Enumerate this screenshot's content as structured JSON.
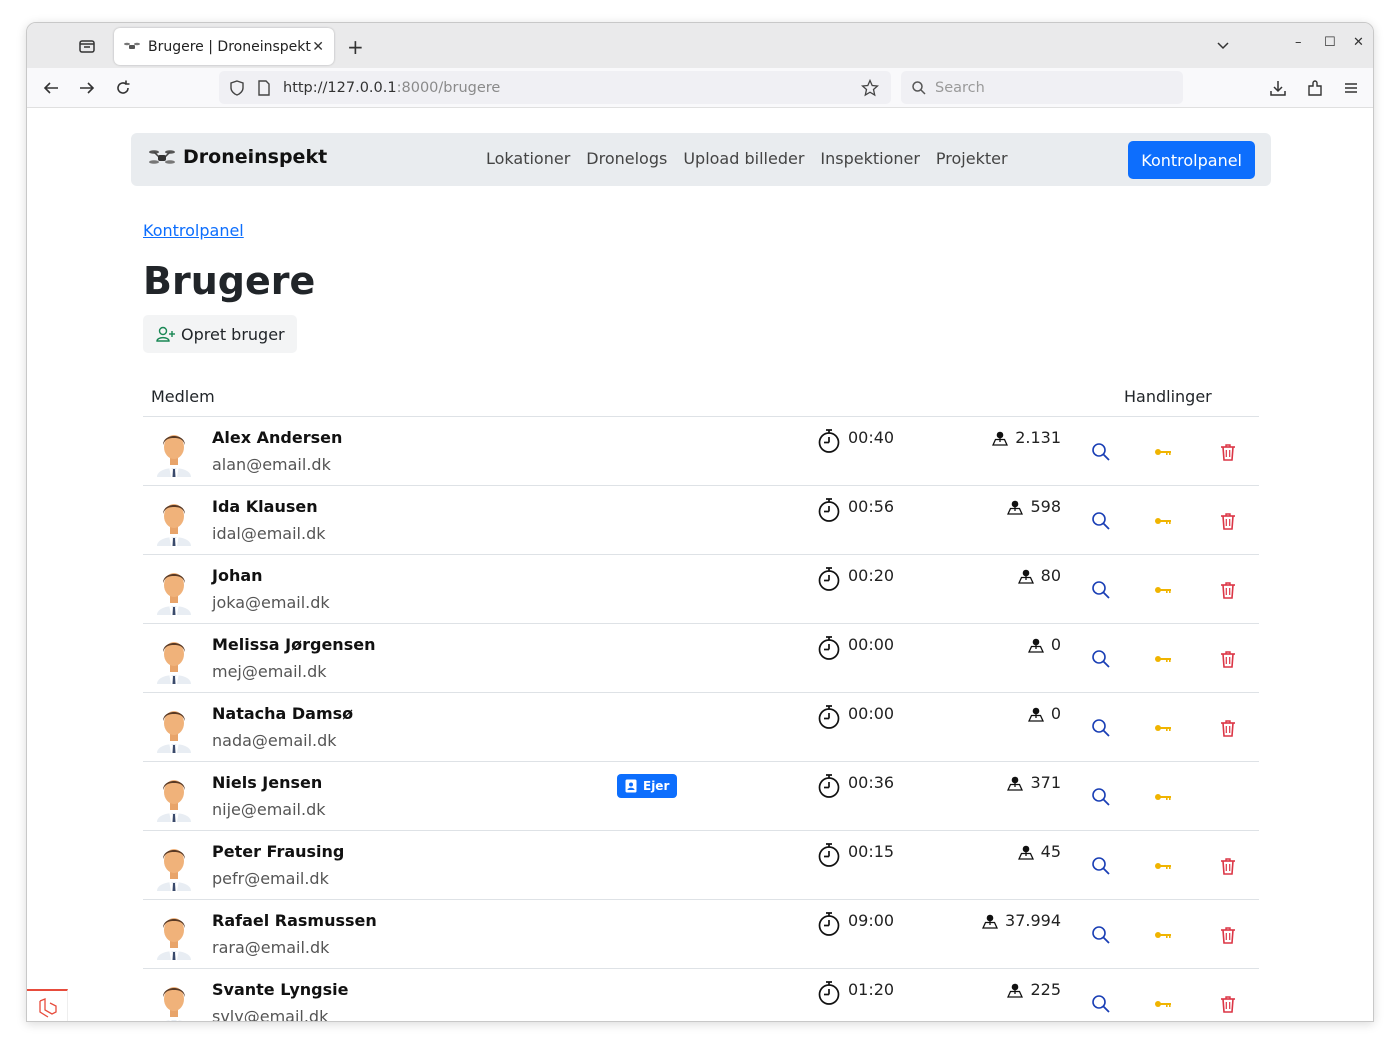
{
  "browser": {
    "tab_title": "Brugere | Droneinspekt",
    "tab_close": "✕",
    "new_tab": "+",
    "url_host": "http://127.0.0.1",
    "url_path": ":8000/brugere",
    "search_placeholder": "Search",
    "window_controls": {
      "minimize": "–",
      "maximize": "☐",
      "close": "✕"
    }
  },
  "site": {
    "brand": "Droneinspekt",
    "menu": [
      "Lokationer",
      "Dronelogs",
      "Upload billeder",
      "Inspektioner",
      "Projekter"
    ],
    "control_panel_button": "Kontrolpanel"
  },
  "page": {
    "breadcrumb": "Kontrolpanel",
    "title": "Brugere",
    "create_button": "Opret bruger",
    "table_headers": {
      "member": "Medlem",
      "actions": "Handlinger"
    }
  },
  "users": [
    {
      "name": "Alex Andersen",
      "email": "alan@email.dk",
      "time": "00:40",
      "count": "2.131",
      "badge": "",
      "deletable": true
    },
    {
      "name": "Ida Klausen",
      "email": "idal@email.dk",
      "time": "00:56",
      "count": "598",
      "badge": "",
      "deletable": true
    },
    {
      "name": "Johan",
      "email": "joka@email.dk",
      "time": "00:20",
      "count": "80",
      "badge": "",
      "deletable": true
    },
    {
      "name": "Melissa Jørgensen",
      "email": "mej@email.dk",
      "time": "00:00",
      "count": "0",
      "badge": "",
      "deletable": true
    },
    {
      "name": "Natacha Damsø",
      "email": "nada@email.dk",
      "time": "00:00",
      "count": "0",
      "badge": "",
      "deletable": true
    },
    {
      "name": "Niels Jensen",
      "email": "nije@email.dk",
      "time": "00:36",
      "count": "371",
      "badge": "Ejer",
      "deletable": false
    },
    {
      "name": "Peter Frausing",
      "email": "pefr@email.dk",
      "time": "00:15",
      "count": "45",
      "badge": "",
      "deletable": true
    },
    {
      "name": "Rafael Rasmussen",
      "email": "rara@email.dk",
      "time": "09:00",
      "count": "37.994",
      "badge": "",
      "deletable": true
    },
    {
      "name": "Svante Lyngsie",
      "email": "svly@email.dk",
      "time": "01:20",
      "count": "225",
      "badge": "",
      "deletable": true
    }
  ],
  "colors": {
    "primary": "#0d6efd",
    "view_icon": "#1a3fb5",
    "key_icon": "#f0b400",
    "delete_icon": "#dc3545",
    "create_icon": "#198754"
  }
}
